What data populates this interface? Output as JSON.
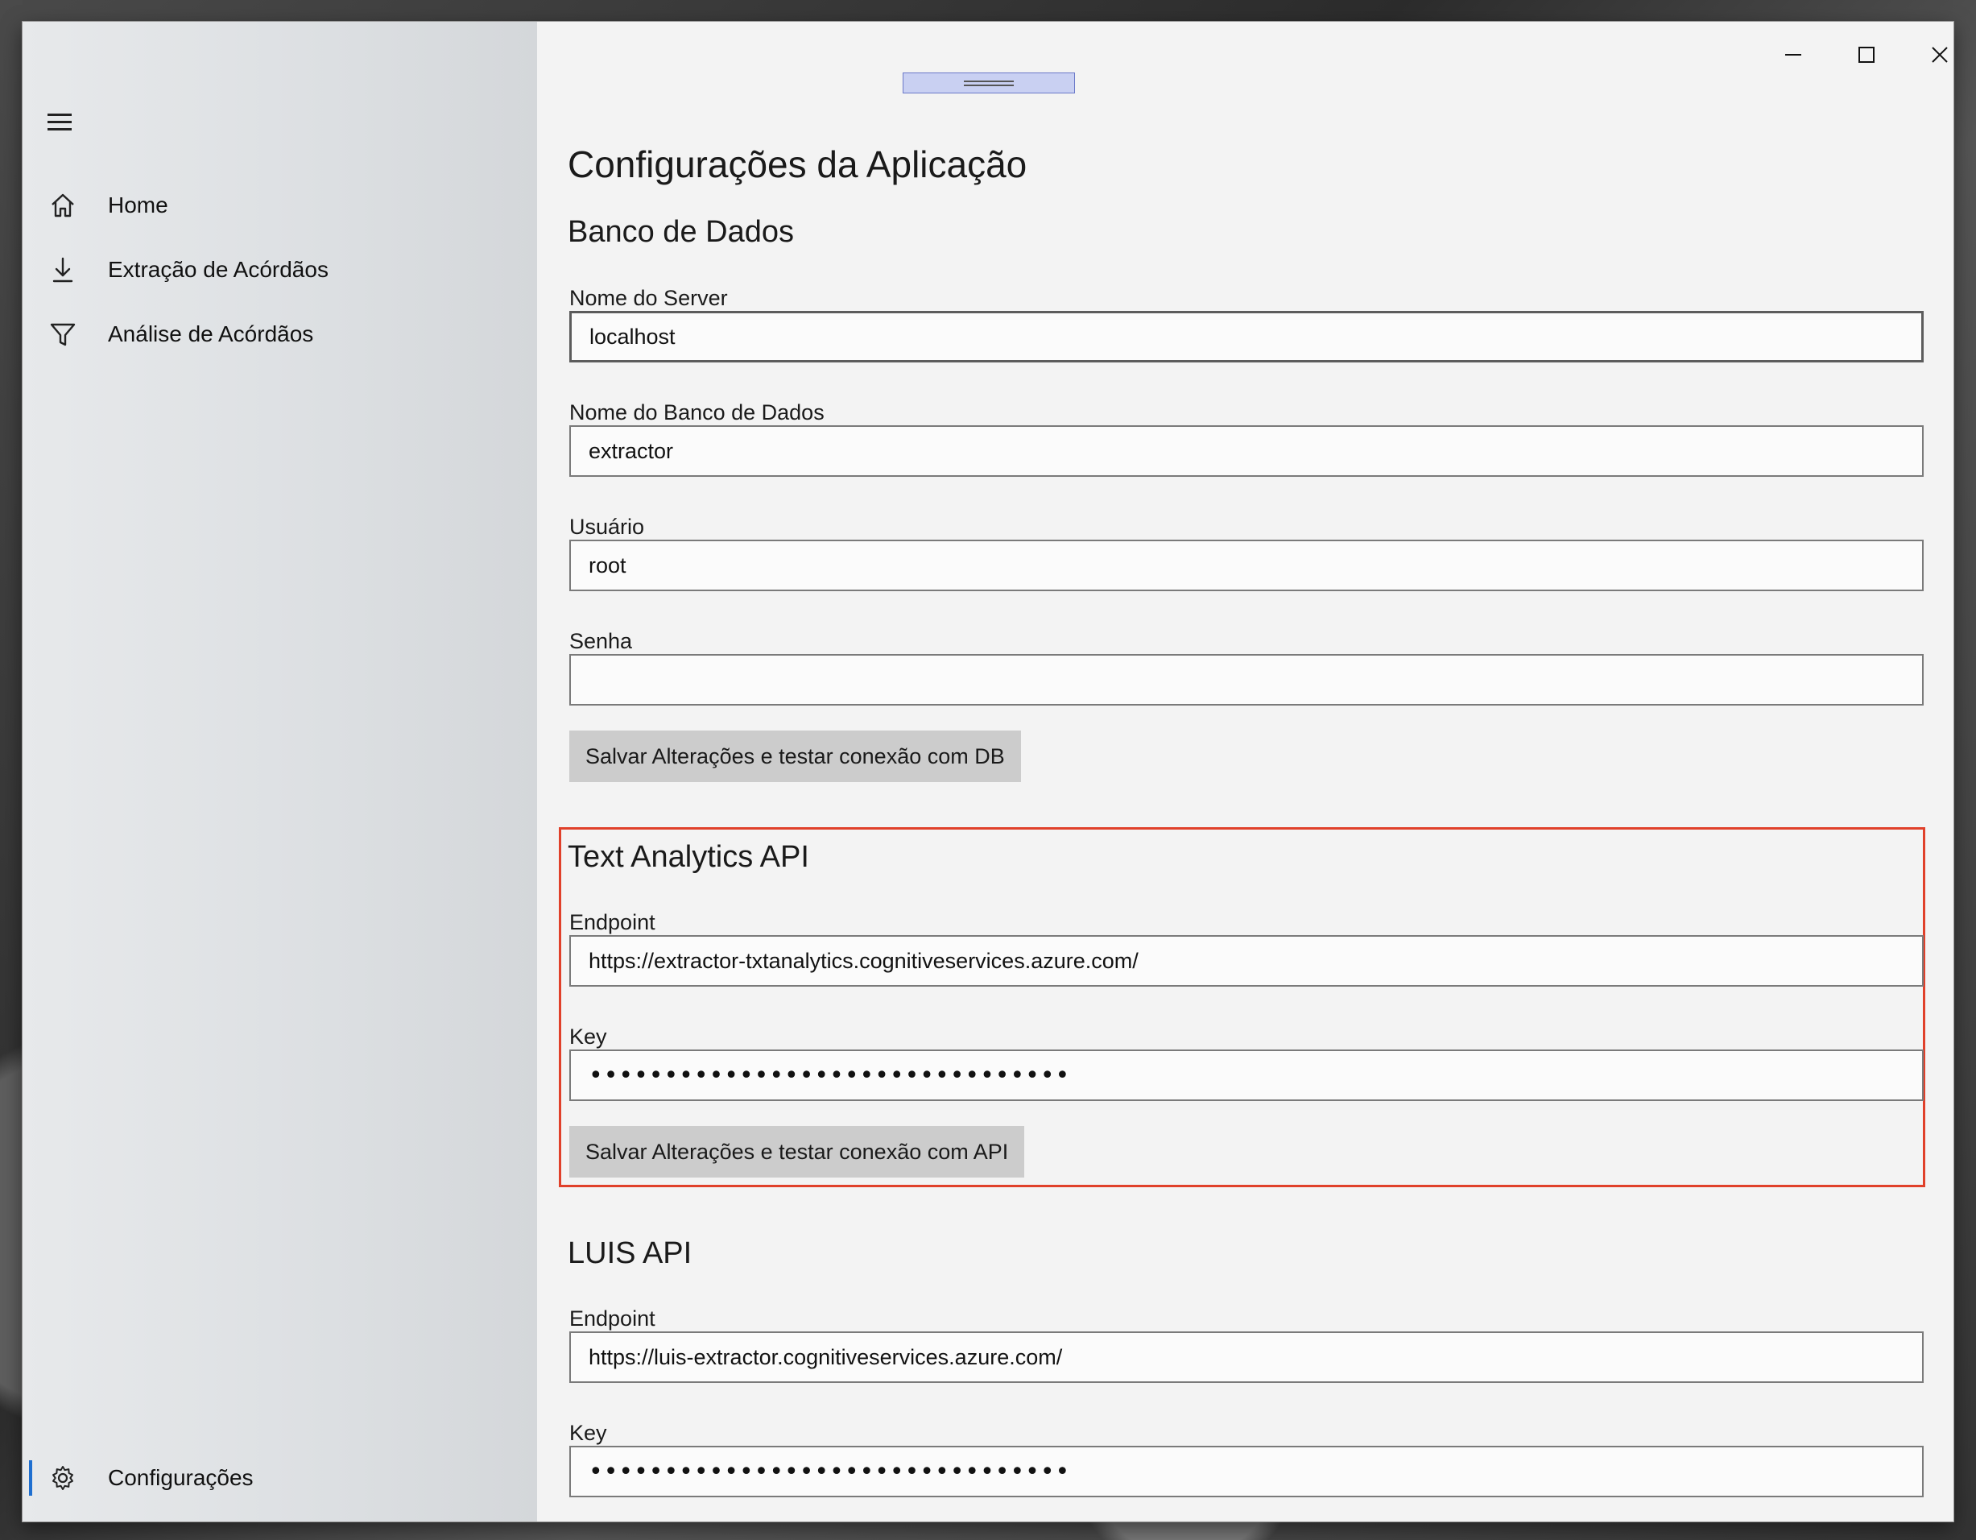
{
  "sidebar": {
    "items": [
      {
        "label": "Home",
        "icon": "home-icon"
      },
      {
        "label": "Extração de Acórdãos",
        "icon": "download-icon"
      },
      {
        "label": "Análise de Acórdãos",
        "icon": "filter-icon"
      }
    ],
    "settings_label": "Configurações",
    "accent_color": "#1f6fd0"
  },
  "window": {
    "controls": [
      "minimize",
      "maximize",
      "close"
    ]
  },
  "page": {
    "title": "Configurações da Aplicação"
  },
  "database": {
    "title": "Banco de Dados",
    "server_label": "Nome do Server",
    "server_value": "localhost",
    "db_label": "Nome do Banco de Dados",
    "db_value": "extractor",
    "user_label": "Usuário",
    "user_value": "root",
    "password_label": "Senha",
    "password_value": "",
    "save_button": "Salvar Alterações e testar conexão com DB"
  },
  "text_analytics": {
    "title": "Text Analytics API",
    "endpoint_label": "Endpoint",
    "endpoint_value": "https://extractor-txtanalytics.cognitiveservices.azure.com/",
    "key_label": "Key",
    "key_value": "••••••••••••••••••••••••••••••••",
    "save_button": "Salvar Alterações e testar conexão com API",
    "highlight_color": "#e0402a"
  },
  "luis": {
    "title": "LUIS API",
    "endpoint_label": "Endpoint",
    "endpoint_value": "https://luis-extractor.cognitiveservices.azure.com/",
    "key_label": "Key",
    "key_value": "••••••••••••••••••••••••••••••••"
  }
}
